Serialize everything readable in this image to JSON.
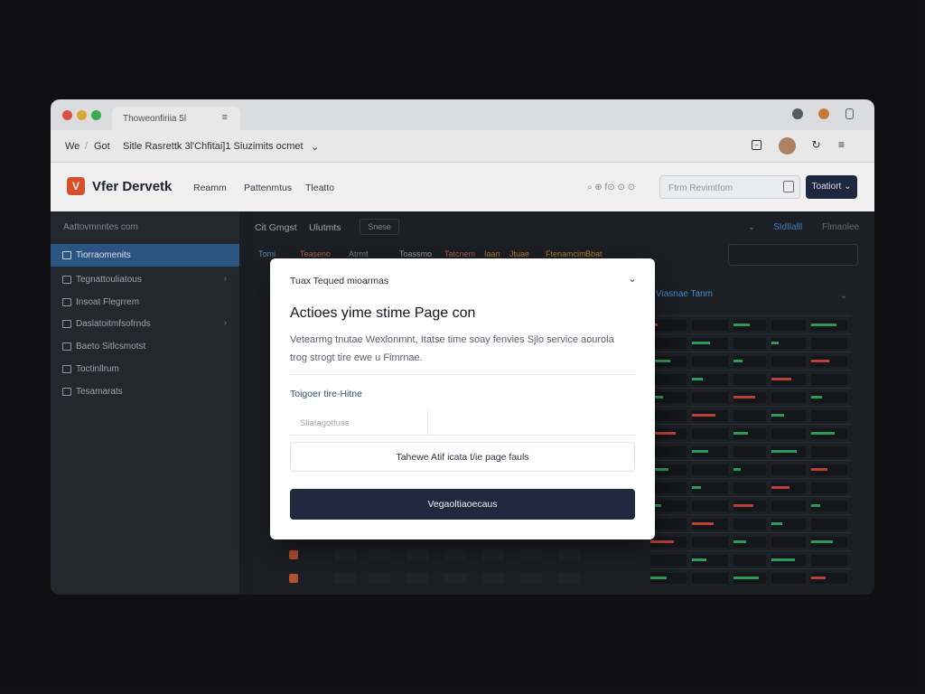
{
  "browser": {
    "tab_title": "Thoweonfiriia 5l",
    "tab_menu": "≡",
    "nav_back": "We",
    "nav_sep": "/",
    "nav_item": "Got",
    "address": "Sitle Rasrettk 3l'Chfitai]1 Siuzimits ocmet",
    "colors": {
      "close": "#e9574a",
      "minimize": "#e8b13a",
      "maximize": "#3fb458"
    }
  },
  "app_header": {
    "logo_letter": "V",
    "logo_text": "Vfer Dervetk",
    "menu": [
      "Reamm",
      "Pattenmtus",
      "Tleatto"
    ],
    "meta": "⌕ ⊕ f⊙ ⊙ ⊙",
    "search_placeholder": "Ftrm Revimtfom",
    "button_label": "Toatiort ⌄"
  },
  "sidebar": {
    "title": "Aattovmnntes com",
    "items": [
      {
        "label": "Tiorraomenits",
        "active": true
      },
      {
        "label": "Tegnattouliatous",
        "active": false
      },
      {
        "label": "Insoat Flegrrem",
        "active": false
      },
      {
        "label": "Daslatoitmfsofrnds",
        "active": false
      },
      {
        "label": "Baeto Sitlcsmotst",
        "active": false
      },
      {
        "label": "Toctinllrum",
        "active": false
      },
      {
        "label": "Tesamarats",
        "active": false
      }
    ]
  },
  "main": {
    "crumb_1": "Cit Gmgst",
    "crumb_2": "Ulutmts",
    "pill": "Snese",
    "right_meta_1": "SIdIlalll",
    "right_meta_2": "Flmaolee",
    "filter_chips": [
      "Tomi",
      "Teaseno",
      "Atrmt",
      "Toassmo",
      "Tatcnem",
      "Iaan",
      "Jtuae",
      "Ftenamcim",
      "Bbat"
    ],
    "panel_title": "Viasnae Tanm"
  },
  "modal": {
    "header": "Tuax  Tequed mioarmas",
    "title": "Actioes yime stime Page con",
    "description": "Vetearmg tnutae Wexlonmnt, Itatse time soay fenvies Sjlo service aourola trog strogt tire ewe u Fimrnae.",
    "field_label": "Toigoer tire-Hitne",
    "field_placeholder": "Sliatagotfuss",
    "secondary_button": "Tahewe Atif icata t/ie page fauls",
    "primary_button": "Vegaoltiaoecaus"
  }
}
